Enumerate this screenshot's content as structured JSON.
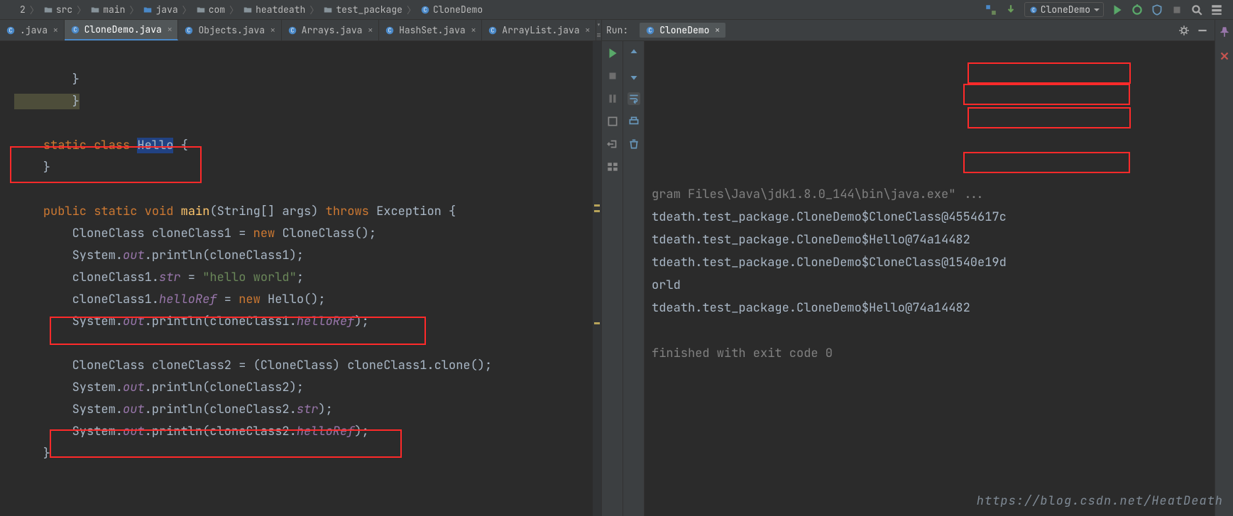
{
  "breadcrumb": {
    "items": [
      {
        "icon": "num",
        "text": "2"
      },
      {
        "icon": "folder",
        "text": "src"
      },
      {
        "icon": "folder",
        "text": "main"
      },
      {
        "icon": "folder-blue",
        "text": "java"
      },
      {
        "icon": "folder",
        "text": "com"
      },
      {
        "icon": "folder",
        "text": "heatdeath"
      },
      {
        "icon": "folder",
        "text": "test_package"
      },
      {
        "icon": "class",
        "text": "CloneDemo"
      }
    ]
  },
  "toolbar": {
    "run_config_label": "CloneDemo",
    "icons": [
      "vcs",
      "run-config",
      "play",
      "debug",
      "coverage",
      "stop",
      "search",
      "structure"
    ]
  },
  "editor_tabs": [
    {
      "label": ".java",
      "active": false
    },
    {
      "label": "CloneDemo.java",
      "active": true
    },
    {
      "label": "Objects.java",
      "active": false
    },
    {
      "label": "Arrays.java",
      "active": false
    },
    {
      "label": "HashSet.java",
      "active": false
    },
    {
      "label": "ArrayList.java",
      "active": false
    }
  ],
  "editor_tabs_overflow": "▾ ≡",
  "code": {
    "l1": "        }",
    "l2": "    }",
    "l3": "",
    "l4_pre": "    ",
    "l4_kw": "static class ",
    "l4_id": "Hello",
    "l4_post": " {",
    "l5": "    }",
    "l6": "",
    "l7_pre": "    ",
    "l7_public": "public ",
    "l7_static": "static ",
    "l7_void": "void ",
    "l7_main": "main",
    "l7_paren": "(",
    "l7_string": "String",
    "l7_arr": "[] ",
    "l7_args": "args) ",
    "l7_throws": "throws ",
    "l7_ex": "Exception {",
    "l8_pre": "        ",
    "l8_type": "CloneClass ",
    "l8_var": "cloneClass1 = ",
    "l8_new": "new ",
    "l8_ctor": "CloneClass();",
    "l9_pre": "        System.",
    "l9_out": "out",
    "l9_rest": ".println(cloneClass1);",
    "l10_pre": "        cloneClass1.",
    "l10_field": "str",
    "l10_eq": " = ",
    "l10_str": "\"hello world\"",
    "l10_semi": ";",
    "l11_pre": "        cloneClass1.",
    "l11_field": "helloRef",
    "l11_eq": " = ",
    "l11_new": "new ",
    "l11_ctor": "Hello();",
    "l12_pre": "        System.",
    "l12_out": "out",
    "l12_mid": ".println(cloneClass1.",
    "l12_field": "helloRef",
    "l12_end": ");",
    "l13": "",
    "l14_pre": "        ",
    "l14_type": "CloneClass ",
    "l14_rest": "cloneClass2 = (CloneClass) cloneClass1.clone();",
    "l15_pre": "        System.",
    "l15_out": "out",
    "l15_rest": ".println(cloneClass2);",
    "l16_pre": "        System.",
    "l16_out": "out",
    "l16_mid": ".println(cloneClass2.",
    "l16_field": "str",
    "l16_end": ");",
    "l17_pre": "        System.",
    "l17_out": "out",
    "l17_mid": ".println(cloneClass2.",
    "l17_field": "helloRef",
    "l17_end": ");",
    "l18": "    }"
  },
  "run": {
    "panel_label": "Run:",
    "tab_label": "CloneDemo",
    "output": [
      "gram Files\\Java\\jdk1.8.0_144\\bin\\java.exe\" ...",
      "tdeath.test_package.CloneDemo$CloneClass@4554617c",
      "tdeath.test_package.CloneDemo$Hello@74a14482",
      "tdeath.test_package.CloneDemo$CloneClass@1540e19d",
      "orld",
      "tdeath.test_package.CloneDemo$Hello@74a14482",
      "",
      "finished with exit code 0"
    ],
    "output_colors": [
      "gray",
      "",
      "",
      "",
      "",
      "",
      "",
      "gray"
    ]
  },
  "watermark": "https://blog.csdn.net/HeatDeath"
}
